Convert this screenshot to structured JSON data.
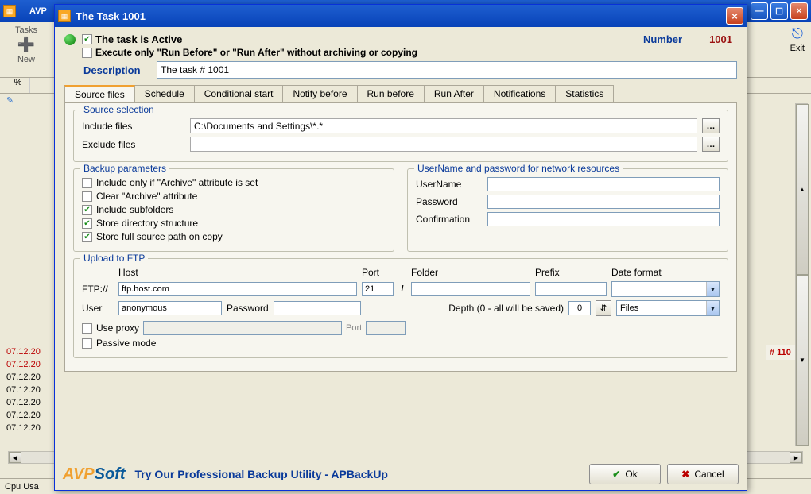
{
  "bgWindow": {
    "title": "AVP",
    "tabsLabel": "Tasks",
    "newLabel": "New",
    "exitLabel": "Exit",
    "colPercent": "%",
    "dates": [
      "07.12.20",
      "07.12.20",
      "07.12.20",
      "07.12.20",
      "07.12.20",
      "07.12.20",
      "07.12.20"
    ],
    "statusLabel": "Cpu Usa",
    "rightBadge": "# 110"
  },
  "dialog": {
    "title": "The Task 1001",
    "activeLabel": "The task is Active",
    "executeOnlyLabel": "Execute only \"Run Before\" or \"Run After\" without archiving or copying",
    "numberLabel": "Number",
    "numberValue": "1001",
    "descriptionLabel": "Description",
    "descriptionValue": "The task # 1001",
    "tabs": [
      "Source files",
      "Schedule",
      "Conditional start",
      "Notify before",
      "Run before",
      "Run After",
      "Notifications",
      "Statistics"
    ],
    "sourceSelection": {
      "title": "Source selection",
      "includeLabel": "Include files",
      "includeValue": "C:\\Documents and Settings\\*.*",
      "excludeLabel": "Exclude files",
      "excludeValue": ""
    },
    "backupParams": {
      "title": "Backup parameters",
      "opts": [
        {
          "label": "Include only if \"Archive\" attribute is set",
          "checked": false
        },
        {
          "label": "Clear \"Archive\" attribute",
          "checked": false
        },
        {
          "label": "Include subfolders",
          "checked": true
        },
        {
          "label": "Store directory structure",
          "checked": true
        },
        {
          "label": "Store full source path on copy",
          "checked": true
        }
      ]
    },
    "netCreds": {
      "title": "UserName and password for network resources",
      "userLabel": "UserName",
      "passLabel": "Password",
      "confLabel": "Confirmation"
    },
    "ftp": {
      "title": "Upload to FTP",
      "hostHdr": "Host",
      "portHdr": "Port",
      "folderHdr": "Folder",
      "prefixHdr": "Prefix",
      "dateHdr": "Date format",
      "ftpLabel": "FTP://",
      "hostValue": "ftp.host.com",
      "portValue": "21",
      "slash": "/",
      "userLabel": "User",
      "userValue": "anonymous",
      "passLabel": "Password",
      "depthLabel": "Depth (0 - all will be saved)",
      "depthValue": "0",
      "filesSelect": "Files",
      "useProxyLabel": "Use proxy",
      "proxyPortLabel": "Port",
      "passiveLabel": "Passive mode"
    },
    "footer": {
      "logoA": "AVP",
      "logoRest": "Soft",
      "promo": "Try Our Professional Backup Utility - APBackUp",
      "ok": "Ok",
      "cancel": "Cancel"
    }
  }
}
